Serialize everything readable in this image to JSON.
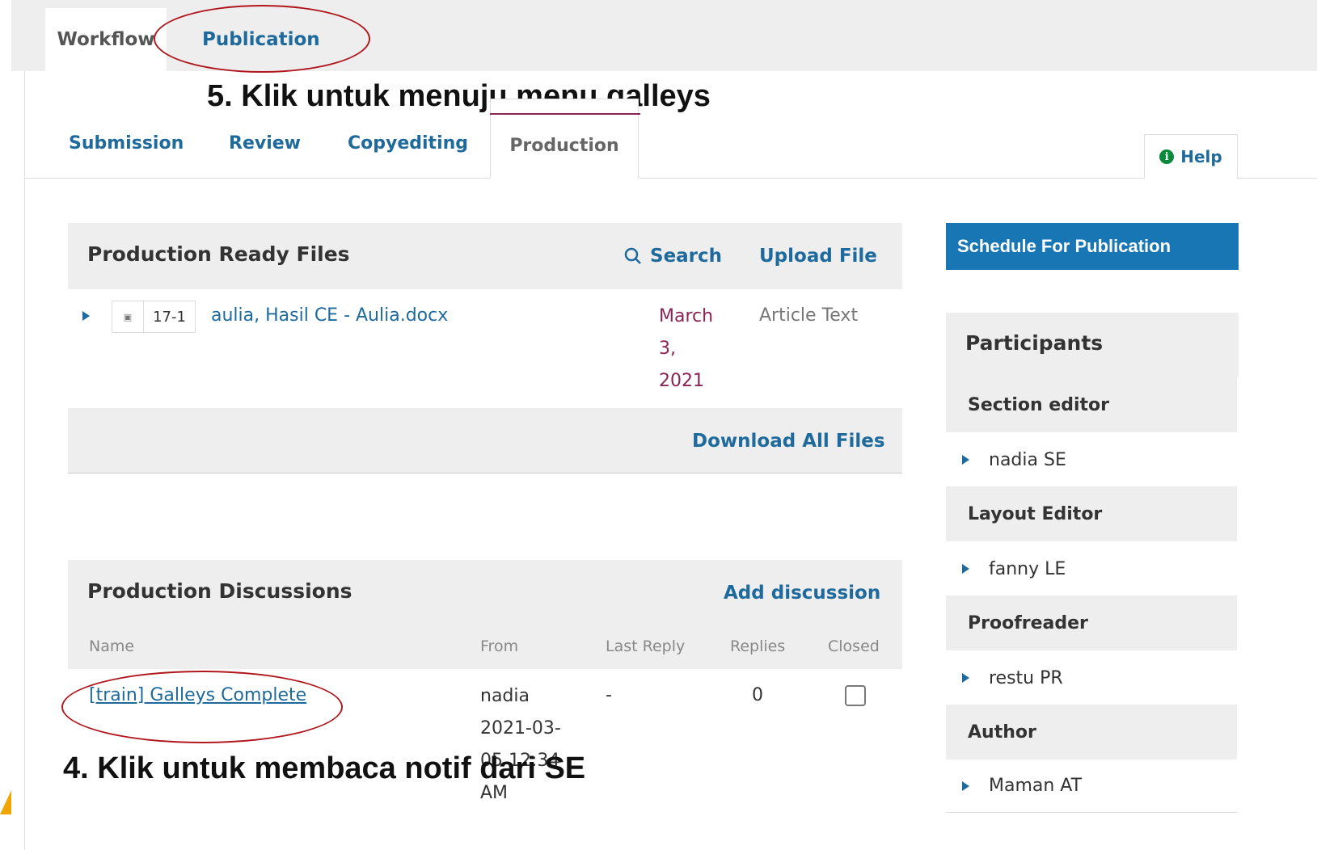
{
  "main_tabs": [
    {
      "label": "Workflow"
    },
    {
      "label": "Publication"
    }
  ],
  "annotations": {
    "step5": "5. Klik untuk menuju menu galleys",
    "step4": "4. Klik untuk membaca notif dari SE"
  },
  "sub_tabs": [
    {
      "label": "Submission"
    },
    {
      "label": "Review"
    },
    {
      "label": "Copyediting"
    },
    {
      "label": "Production"
    }
  ],
  "help": {
    "label": "Help",
    "icon": "info-icon"
  },
  "production_ready_files": {
    "title": "Production Ready Files",
    "search_label": "Search",
    "upload_label": "Upload File",
    "files": [
      {
        "id": "17-1",
        "name": "aulia, Hasil CE - Aulia.docx",
        "date_lines": [
          "March",
          "3,",
          "2021"
        ],
        "type": "Article Text"
      }
    ],
    "download_all_label": "Download All Files"
  },
  "production_discussions": {
    "title": "Production Discussions",
    "add_label": "Add discussion",
    "columns": [
      "Name",
      "From",
      "Last Reply",
      "Replies",
      "Closed"
    ],
    "rows": [
      {
        "name": "[train] Galleys Complete",
        "from_lines": [
          "nadia",
          "2021-03-",
          "05 12:34",
          "AM"
        ],
        "last_reply": "-",
        "replies": "0",
        "closed": false
      }
    ]
  },
  "sidebar": {
    "schedule_label": "Schedule For Publication",
    "participants_title": "Participants",
    "roles": [
      {
        "role": "Section editor",
        "person": "nadia SE"
      },
      {
        "role": "Layout Editor",
        "person": "fanny LE"
      },
      {
        "role": "Proofreader",
        "person": "restu PR"
      },
      {
        "role": "Author",
        "person": "Maman AT"
      }
    ]
  },
  "colors": {
    "link": "#1e6a9c",
    "date": "#8b2456",
    "primary_button": "#1776b3",
    "annotation_circle": "#b0181e"
  }
}
